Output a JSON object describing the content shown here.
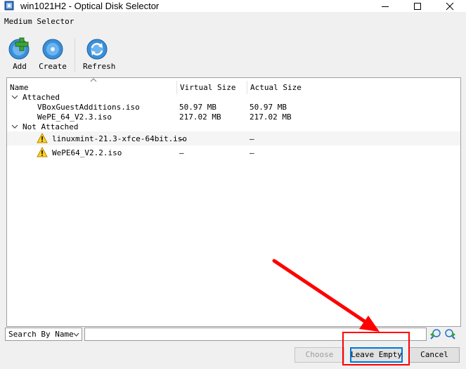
{
  "window": {
    "title": "win1021H2 - Optical Disk Selector"
  },
  "dialog": {
    "subtitle": "Medium Selector"
  },
  "toolbar": {
    "add_label": "Add",
    "create_label": "Create",
    "refresh_label": "Refresh"
  },
  "table": {
    "columns": [
      "Name",
      "Virtual Size",
      "Actual Size"
    ],
    "groups": [
      {
        "label": "Attached",
        "items": [
          {
            "name": "VBoxGuestAdditions.iso",
            "virtual": "50.97 MB",
            "actual": "50.97 MB",
            "warning": false
          },
          {
            "name": "WePE_64_V2.3.iso",
            "virtual": "217.02 MB",
            "actual": "217.02 MB",
            "warning": false
          }
        ]
      },
      {
        "label": "Not Attached",
        "items": [
          {
            "name": "linuxmint-21.3-xfce-64bit.iso",
            "virtual": "—",
            "actual": "—",
            "warning": true
          },
          {
            "name": "WePE64_V2.2.iso",
            "virtual": "—",
            "actual": "—",
            "warning": true
          }
        ]
      }
    ]
  },
  "search": {
    "mode": "Search By Name",
    "value": ""
  },
  "buttons": {
    "choose": "Choose",
    "leave_empty": "Leave Empty",
    "cancel": "Cancel"
  },
  "colors": {
    "annotation": "#ff0000",
    "focus": "#0078d7"
  }
}
